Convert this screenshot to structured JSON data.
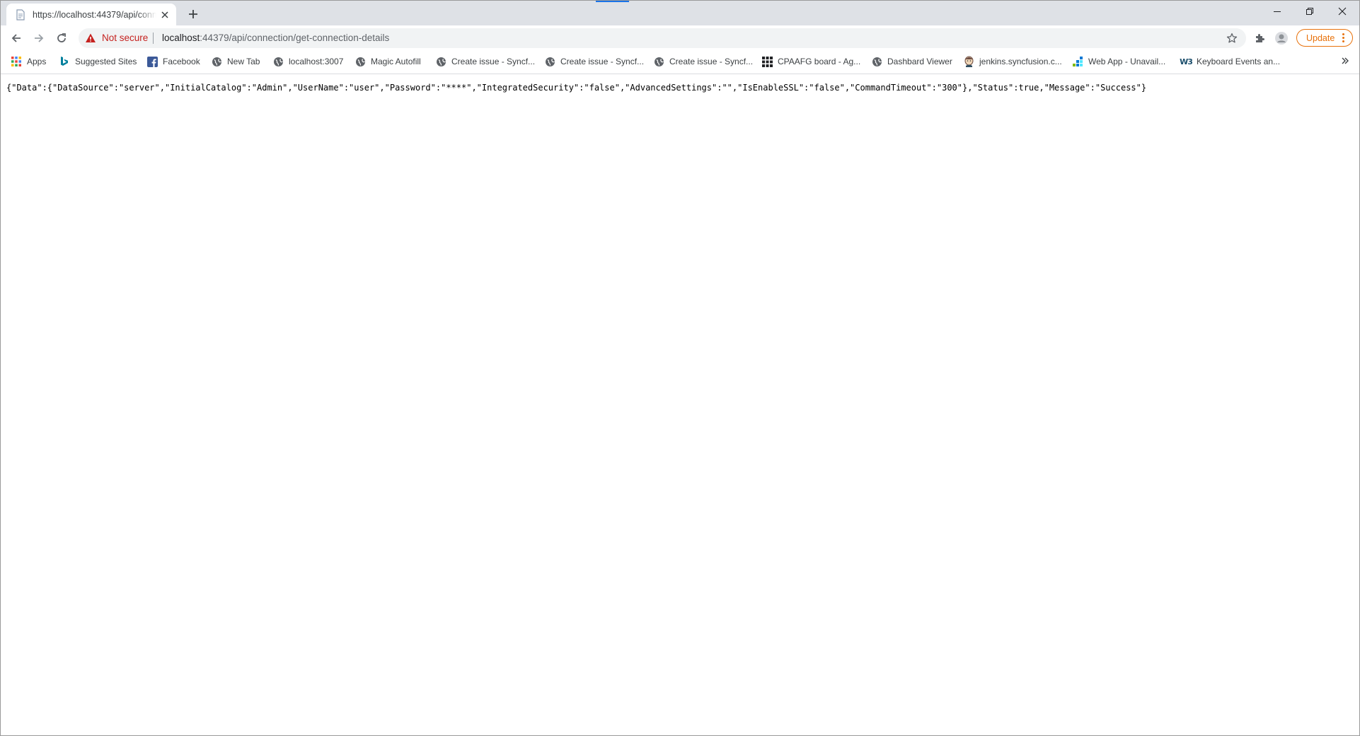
{
  "tab": {
    "title": "https://localhost:44379/api/connection/get-connection-details",
    "close_icon": "close-icon"
  },
  "omnibox": {
    "security_label": "Not secure",
    "url_host": "localhost",
    "url_rest": ":44379/api/connection/get-connection-details"
  },
  "toolbar": {
    "update_label": "Update"
  },
  "bookmarks": [
    {
      "label": "Apps",
      "icon": "apps-grid-icon"
    },
    {
      "label": "Suggested Sites",
      "icon": "bing-icon"
    },
    {
      "label": "Facebook",
      "icon": "facebook-icon"
    },
    {
      "label": "New Tab",
      "icon": "globe-icon"
    },
    {
      "label": "localhost:3007",
      "icon": "globe-icon"
    },
    {
      "label": "Magic Autofill",
      "icon": "globe-icon"
    },
    {
      "label": "Create issue - Syncf...",
      "icon": "globe-icon"
    },
    {
      "label": "Create issue - Syncf...",
      "icon": "globe-icon"
    },
    {
      "label": "Create issue - Syncf...",
      "icon": "globe-icon"
    },
    {
      "label": "CPAAFG board - Ag...",
      "icon": "board-grid-icon"
    },
    {
      "label": "Dashbard Viewer",
      "icon": "globe-icon"
    },
    {
      "label": "jenkins.syncfusion.c...",
      "icon": "jenkins-icon"
    },
    {
      "label": "Web App - Unavail...",
      "icon": "webapp-icon"
    },
    {
      "label": "Keyboard Events an...",
      "icon": "w3schools-icon"
    }
  ],
  "page": {
    "json_text": "{\"Data\":{\"DataSource\":\"server\",\"InitialCatalog\":\"Admin\",\"UserName\":\"user\",\"Password\":\"****\",\"IntegratedSecurity\":\"false\",\"AdvancedSettings\":\"\",\"IsEnableSSL\":\"false\",\"CommandTimeout\":\"300\"},\"Status\":true,\"Message\":\"Success\"}"
  },
  "colors": {
    "tabstrip": "#dee1e6",
    "accent": "#1a73e8",
    "warning": "#c5221f",
    "update": "#e8710a"
  }
}
